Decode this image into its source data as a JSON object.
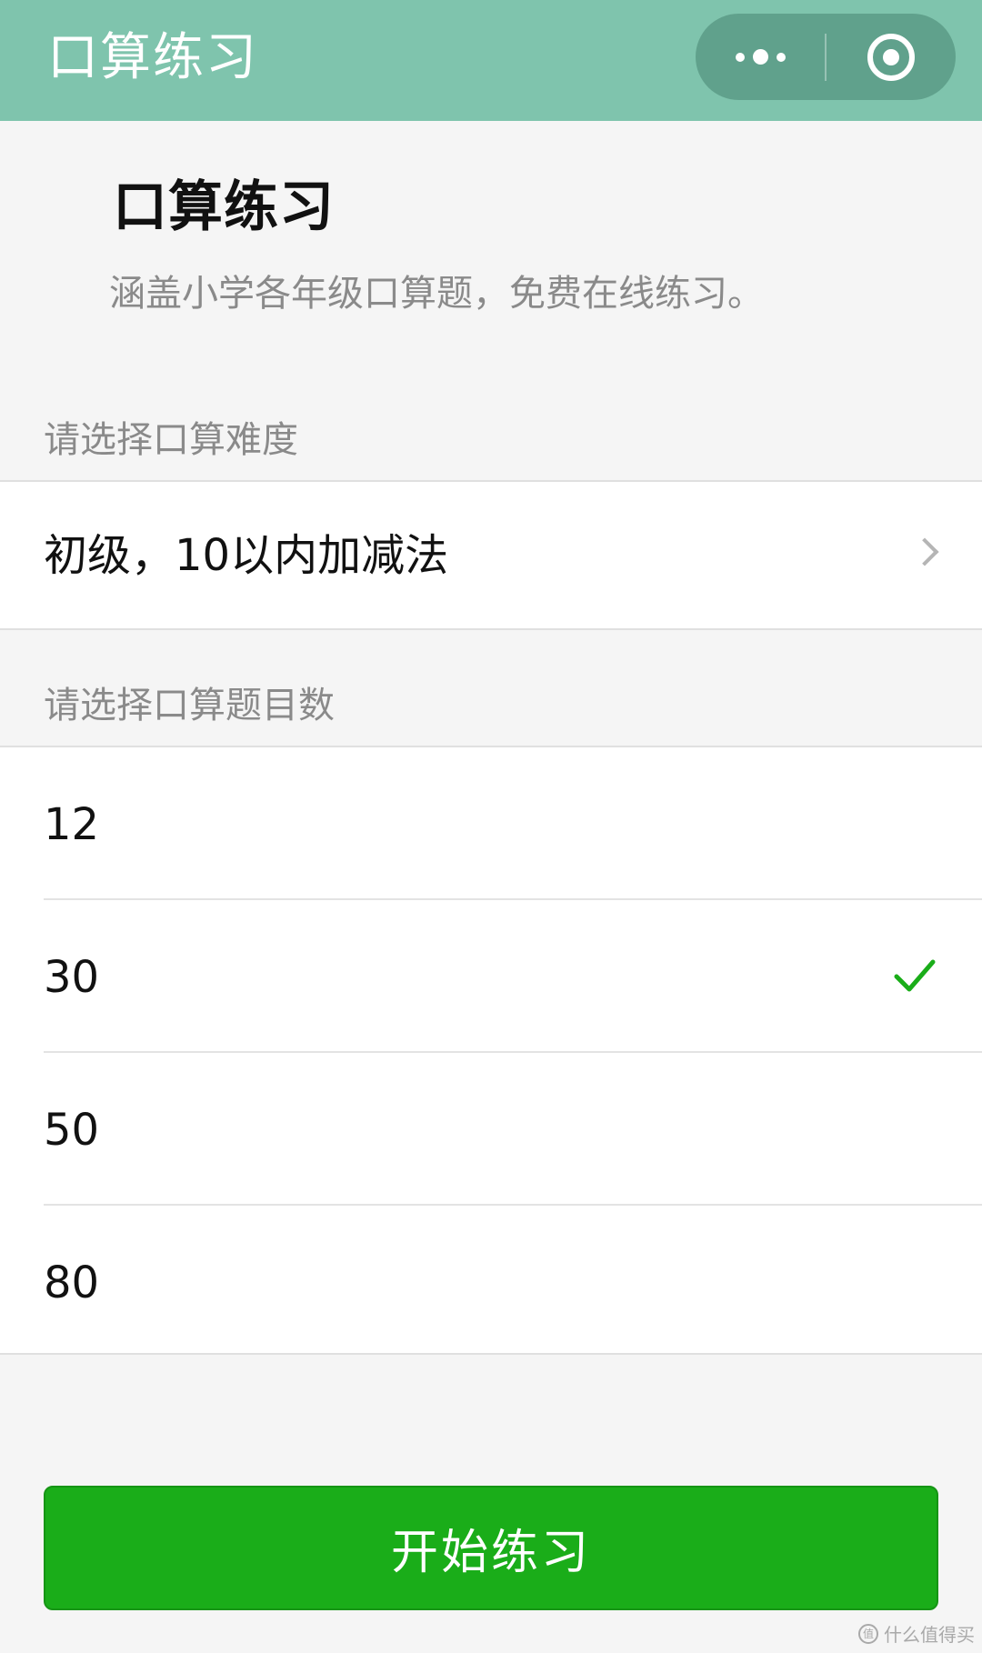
{
  "topbar": {
    "title": "口算练习",
    "more_icon": "more-dots-icon",
    "close_icon": "target-circle-icon"
  },
  "intro": {
    "heading": "口算练习",
    "description": "涵盖小学各年级口算题，免费在线练习。"
  },
  "difficulty": {
    "label": "请选择口算难度",
    "selected": "初级，10以内加减法"
  },
  "count": {
    "label": "请选择口算题目数",
    "options": [
      {
        "value": "12",
        "selected": false
      },
      {
        "value": "30",
        "selected": true
      },
      {
        "value": "50",
        "selected": false
      },
      {
        "value": "80",
        "selected": false
      }
    ]
  },
  "start_button": {
    "label": "开始练习"
  },
  "watermark": {
    "text": "什么值得买"
  },
  "colors": {
    "topbar": "#7fc4ad",
    "accent_green": "#1aad19",
    "check": "#1aad19"
  }
}
